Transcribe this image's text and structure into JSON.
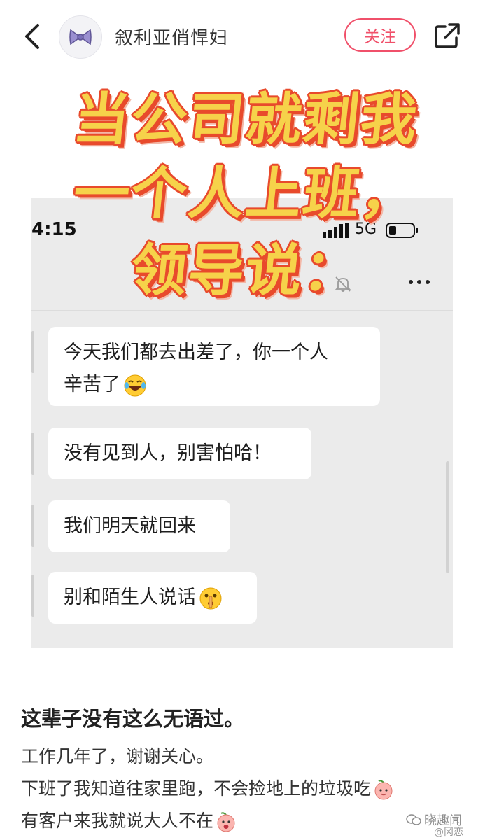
{
  "header": {
    "username": "叙利亚俏悍妇",
    "follow_label": "关注"
  },
  "overlay_title": {
    "line1": "当公司就剩我",
    "line2": "一个人上班，",
    "line3": "领导说："
  },
  "screenshot": {
    "status_time": "4:15",
    "network": "5G",
    "messages": [
      {
        "line1": "今天我们都去出差了，你一个人",
        "line2": "辛苦了",
        "emoji": "tears-of-joy-emoji"
      },
      {
        "line1": "没有见到人，别害怕哈！"
      },
      {
        "line1": "我们明天就回来"
      },
      {
        "line1": "别和陌生人说话",
        "emoji": "shushing-face-emoji"
      }
    ]
  },
  "post": {
    "title": "这辈子没有这么无语过。",
    "lines": [
      "工作几年了，谢谢关心。",
      "下班了我知道往家里跑，不会捡地上的垃圾吃",
      "有客户来我就说大人不在"
    ]
  },
  "watermark": {
    "label": "晓趣闻",
    "sub": "@冈恋"
  },
  "colors": {
    "accent": "#f0506a",
    "title_fill": "#f6d24a",
    "title_outline": "#e84a2c",
    "panel_bg": "#ebebeb"
  }
}
